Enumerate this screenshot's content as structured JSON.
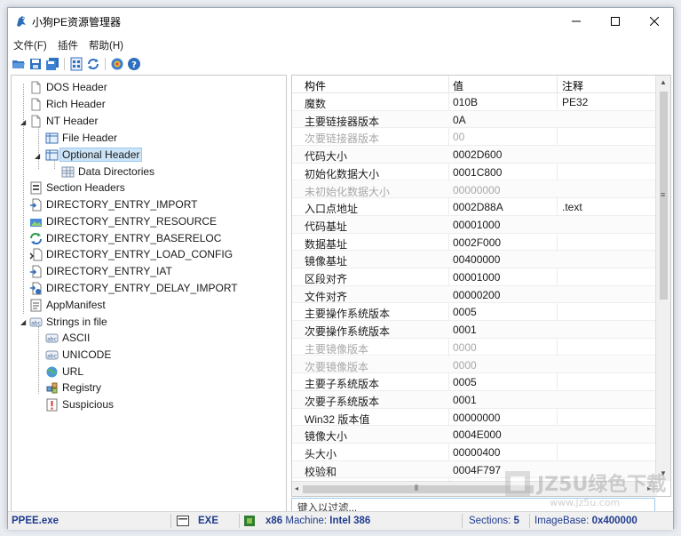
{
  "window": {
    "title": "小狗PE资源管理器"
  },
  "menu": [
    "文件(F)",
    "插件",
    "帮助(H)"
  ],
  "toolbar": {
    "buttons": [
      "open-folder-icon",
      "save-icon",
      "save-all-icon",
      "binary-icon",
      "refresh-icon",
      "plugin-icon",
      "help-icon"
    ]
  },
  "tree": {
    "nodes": [
      {
        "label": "DOS Header",
        "icon": "document-icon"
      },
      {
        "label": "Rich Header",
        "icon": "document-icon"
      },
      {
        "label": "NT Header",
        "icon": "document-icon"
      },
      {
        "label": "File Header",
        "icon": "table-icon"
      },
      {
        "label": "Optional Header",
        "icon": "table-icon"
      },
      {
        "label": "Data Directories",
        "icon": "grid-icon"
      },
      {
        "label": "Section Headers",
        "icon": "sections-icon"
      },
      {
        "label": "DIRECTORY_ENTRY_IMPORT",
        "icon": "import-icon"
      },
      {
        "label": "DIRECTORY_ENTRY_RESOURCE",
        "icon": "resource-icon"
      },
      {
        "label": "DIRECTORY_ENTRY_BASERELOC",
        "icon": "reloc-icon"
      },
      {
        "label": "DIRECTORY_ENTRY_LOAD_CONFIG",
        "icon": "config-icon"
      },
      {
        "label": "DIRECTORY_ENTRY_IAT",
        "icon": "import-icon"
      },
      {
        "label": "DIRECTORY_ENTRY_DELAY_IMPORT",
        "icon": "delay-import-icon"
      },
      {
        "label": "AppManifest",
        "icon": "manifest-icon"
      },
      {
        "label": "Strings in file",
        "icon": "strings-icon"
      },
      {
        "label": "ASCII",
        "icon": "strings-icon"
      },
      {
        "label": "UNICODE",
        "icon": "strings-icon"
      },
      {
        "label": "URL",
        "icon": "globe-icon"
      },
      {
        "label": "Registry",
        "icon": "registry-icon"
      },
      {
        "label": "Suspicious",
        "icon": "warning-icon"
      }
    ]
  },
  "grid": {
    "columns": [
      "构件",
      "值",
      "注释"
    ],
    "rows": [
      {
        "field": "魔数",
        "value": "010B",
        "note": "PE32",
        "dim": false
      },
      {
        "field": "主要链接器版本",
        "value": "0A",
        "note": "",
        "dim": false
      },
      {
        "field": "次要链接器版本",
        "value": "00",
        "note": "",
        "dim": true
      },
      {
        "field": "代码大小",
        "value": "0002D600",
        "note": "",
        "dim": false
      },
      {
        "field": "初始化数据大小",
        "value": "0001C800",
        "note": "",
        "dim": false
      },
      {
        "field": "未初始化数据大小",
        "value": "00000000",
        "note": "",
        "dim": true
      },
      {
        "field": "入口点地址",
        "value": "0002D88A",
        "note": ".text",
        "dim": false
      },
      {
        "field": "代码基址",
        "value": "00001000",
        "note": "",
        "dim": false
      },
      {
        "field": "数据基址",
        "value": "0002F000",
        "note": "",
        "dim": false
      },
      {
        "field": "镜像基址",
        "value": "00400000",
        "note": "",
        "dim": false
      },
      {
        "field": "区段对齐",
        "value": "00001000",
        "note": "",
        "dim": false
      },
      {
        "field": "文件对齐",
        "value": "00000200",
        "note": "",
        "dim": false
      },
      {
        "field": "主要操作系统版本",
        "value": "0005",
        "note": "",
        "dim": false
      },
      {
        "field": "次要操作系统版本",
        "value": "0001",
        "note": "",
        "dim": false
      },
      {
        "field": "主要镜像版本",
        "value": "0000",
        "note": "",
        "dim": true
      },
      {
        "field": "次要镜像版本",
        "value": "0000",
        "note": "",
        "dim": true
      },
      {
        "field": "主要子系统版本",
        "value": "0005",
        "note": "",
        "dim": false
      },
      {
        "field": "次要子系统版本",
        "value": "0001",
        "note": "",
        "dim": false
      },
      {
        "field": "Win32 版本值",
        "value": "00000000",
        "note": "",
        "dim": false
      },
      {
        "field": "镜像大小",
        "value": "0004E000",
        "note": "",
        "dim": false
      },
      {
        "field": "头大小",
        "value": "00000400",
        "note": "",
        "dim": false
      },
      {
        "field": "校验和",
        "value": "0004F797",
        "note": "",
        "dim": false
      }
    ]
  },
  "filter": {
    "placeholder": "键入以过滤..."
  },
  "status": {
    "file": "PPEE.exe",
    "type": "EXE",
    "arch": "x86",
    "machine_label": "Machine:",
    "machine_value": "Intel 386",
    "sections_label": "Sections:",
    "sections_value": "5",
    "imagebase_label": "ImageBase:",
    "imagebase_value": "0x400000"
  },
  "watermark": {
    "text": "JZ5U绿色下载",
    "url": "www.jz5u.com"
  },
  "colors": {
    "accent": "#1f3b8e",
    "selection": "#cce4f7",
    "filter_border": "#9ecbf0"
  }
}
